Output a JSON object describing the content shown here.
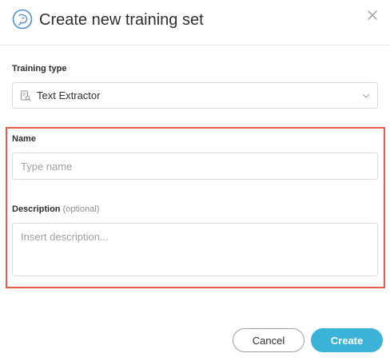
{
  "dialog": {
    "title": "Create new training set",
    "icons": {
      "title": "brain-icon",
      "close": "close-icon",
      "select": "document-scan-icon",
      "select_arrow": "chevron-down-icon"
    }
  },
  "form": {
    "training_type": {
      "label": "Training type",
      "selected": "Text Extractor"
    },
    "name": {
      "label": "Name",
      "value": "",
      "placeholder": "Type name"
    },
    "description": {
      "label": "Description",
      "optional_text": "(optional)",
      "value": "",
      "placeholder": "Insert description..."
    }
  },
  "buttons": {
    "cancel": "Cancel",
    "create": "Create"
  },
  "colors": {
    "accent": "#3bb3d8",
    "highlight": "#e55a4f",
    "border": "#d6dadf"
  }
}
